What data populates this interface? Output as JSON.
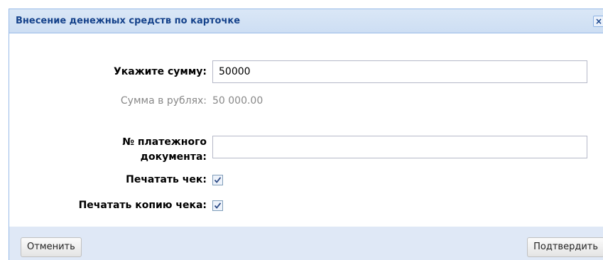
{
  "dialog": {
    "title": "Внесение денежных средств по карточке",
    "close_icon": "close-icon"
  },
  "form": {
    "amount": {
      "label": "Укажите сумму:",
      "value": "50000"
    },
    "rubles": {
      "label": "Сумма в рублях:",
      "value": "50 000.00"
    },
    "doc_number": {
      "label_line1": "№ платежного",
      "label_line2": "документа:",
      "value": ""
    },
    "print_check": {
      "label": "Печатать чек:",
      "checked": true
    },
    "print_copy": {
      "label": "Печатать копию чека:",
      "checked": true
    }
  },
  "footer": {
    "cancel_label": "Отменить",
    "confirm_label": "Подтвердить"
  },
  "colors": {
    "title_text": "#15428b",
    "header_bg": "#cddef3",
    "footer_bg": "#dfe8f6"
  }
}
